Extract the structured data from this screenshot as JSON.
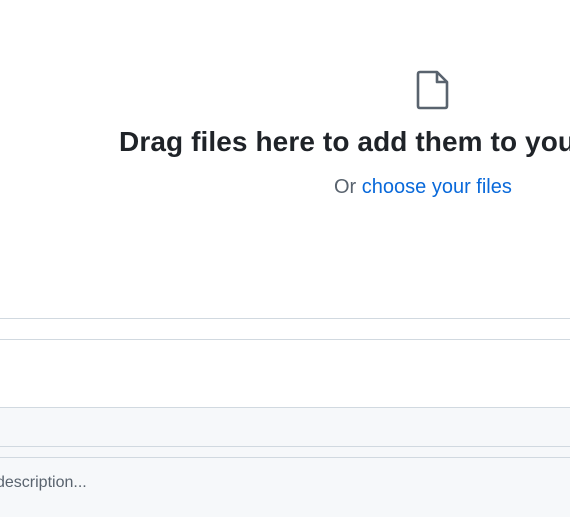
{
  "dropzone": {
    "icon": "file-icon",
    "title": "Drag files here to add them to your repository",
    "choose_prefix": "Or ",
    "choose_link": "choose your files"
  },
  "commit": {
    "description_placeholder": "description...",
    "description_value": ""
  },
  "colors": {
    "title": "#1f2328",
    "muted": "#59636e",
    "link": "#0969da",
    "border": "#d1d9e0",
    "subtle_bg": "#f6f8fa"
  }
}
